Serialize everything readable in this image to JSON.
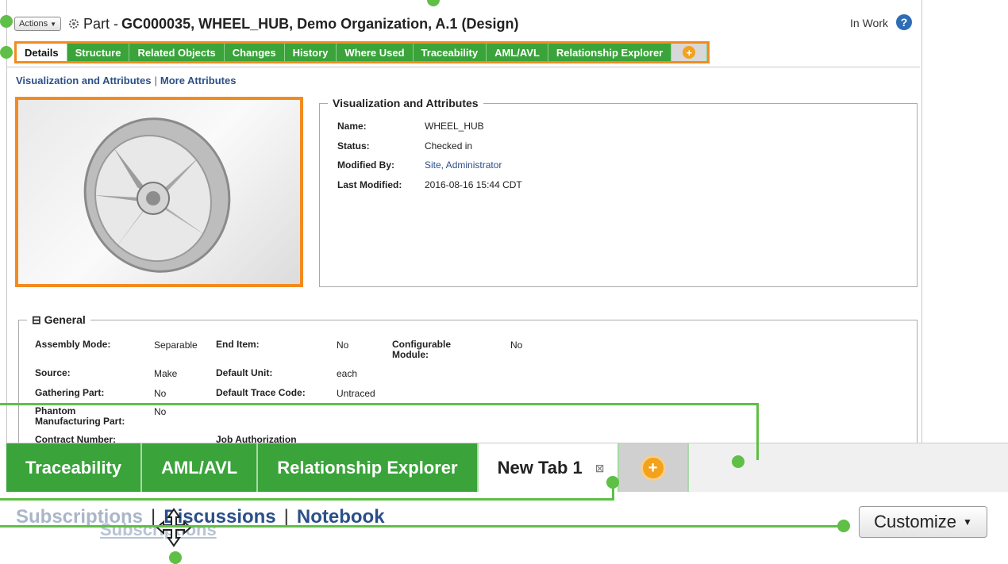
{
  "header": {
    "actions_label": "Actions",
    "title_prefix": "Part - ",
    "title_bold": "GC000035, WHEEL_HUB, Demo Organization, A.1 (Design)",
    "status": "In Work",
    "help_symbol": "?"
  },
  "tabs": [
    {
      "label": "Details",
      "active": true
    },
    {
      "label": "Structure"
    },
    {
      "label": "Related Objects"
    },
    {
      "label": "Changes"
    },
    {
      "label": "History"
    },
    {
      "label": "Where Used"
    },
    {
      "label": "Traceability"
    },
    {
      "label": "AML/AVL"
    },
    {
      "label": "Relationship Explorer"
    }
  ],
  "sublinks": {
    "first": "Visualization and Attributes",
    "sep": "|",
    "second": "More Attributes"
  },
  "visualization": {
    "legend": "Visualization and Attributes",
    "rows": [
      {
        "key": "Name:",
        "value": "WHEEL_HUB"
      },
      {
        "key": "Status:",
        "value": "Checked in"
      },
      {
        "key": "Modified By:",
        "value": "Site, Administrator"
      },
      {
        "key": "Last Modified:",
        "value": "2016-08-16 15:44 CDT"
      }
    ]
  },
  "general": {
    "legend": "General",
    "toggle": "⊟",
    "assembly_mode_k": "Assembly Mode:",
    "assembly_mode_v": "Separable",
    "end_item_k": "End Item:",
    "end_item_v": "No",
    "configurable_k": "Configurable Module:",
    "configurable_v": "No",
    "source_k": "Source:",
    "source_v": "Make",
    "default_unit_k": "Default Unit:",
    "default_unit_v": "each",
    "gathering_k": "Gathering Part:",
    "gathering_v": "No",
    "trace_k": "Default Trace Code:",
    "trace_v": "Untraced",
    "phantom_k": "Phantom Manufacturing Part:",
    "phantom_v": "No",
    "contract_k": "Contract Number:",
    "job_k": "Job Authorization"
  },
  "zoom": {
    "tabs": [
      "Traceability",
      "AML/AVL",
      "Relationship Explorer"
    ],
    "new_tab": "New Tab 1",
    "close": "⊠",
    "links_faded": "Subscriptions",
    "links_sep": "|",
    "link_discussions": "Discussions",
    "link_notebook": "Notebook",
    "ghost": "Subscriptions",
    "customize": "Customize"
  },
  "colors": {
    "tab_green": "#3aa33a",
    "highlight_orange": "#f28b1f",
    "callout_green": "#5fbf46"
  }
}
